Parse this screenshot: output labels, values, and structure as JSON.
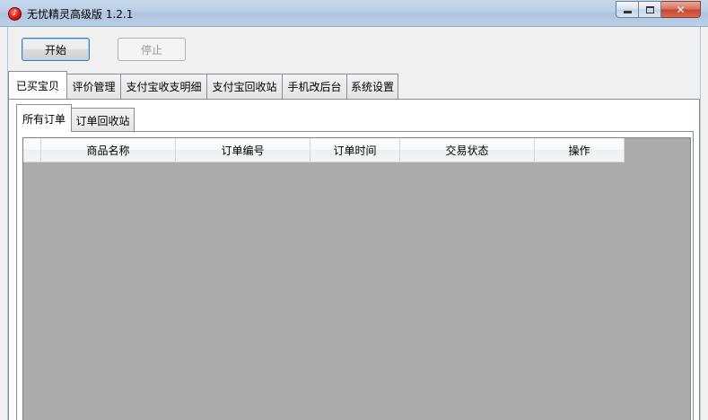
{
  "window": {
    "title": "无忧精灵高级版 1.2.1",
    "app_icon": "♪",
    "close_glyph": "✕"
  },
  "toolbar": {
    "start_label": "开始",
    "stop_label": "停止"
  },
  "main_tabs": [
    {
      "label": "已买宝贝",
      "active": true
    },
    {
      "label": "评价管理"
    },
    {
      "label": "支付宝收支明细"
    },
    {
      "label": "支付宝回收站"
    },
    {
      "label": "手机改后台"
    },
    {
      "label": "系统设置"
    }
  ],
  "sub_tabs": [
    {
      "label": "所有订单",
      "active": true
    },
    {
      "label": "订单回收站"
    }
  ],
  "grid": {
    "columns": [
      "商品名称",
      "订单编号",
      "订单时间",
      "交易状态",
      "操作"
    ]
  }
}
